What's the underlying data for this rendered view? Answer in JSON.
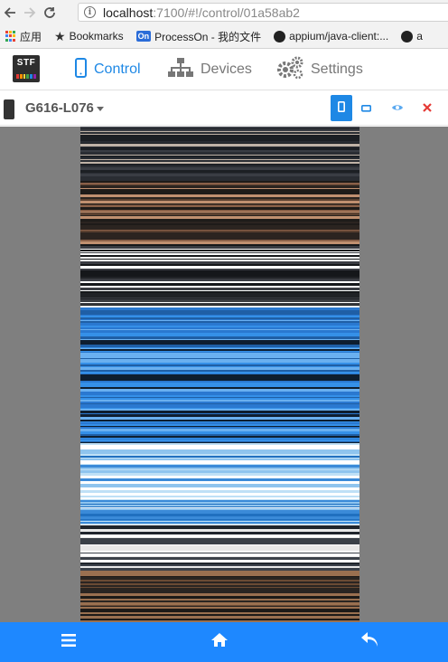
{
  "browser": {
    "url_host": "localhost",
    "url_rest": ":7100/#!/control/01a58ab2"
  },
  "bookmarks": [
    {
      "label": "应用",
      "icon": "apps-grid-icon"
    },
    {
      "label": "Bookmarks",
      "icon": "star-icon"
    },
    {
      "label": "ProcessOn - 我的文件",
      "icon": "processon-icon",
      "badge": "On"
    },
    {
      "label": "appium/java-client:...",
      "icon": "github-icon"
    },
    {
      "label": "a",
      "icon": "github-icon"
    }
  ],
  "logo_text": "STF",
  "nav": {
    "control": "Control",
    "devices": "Devices",
    "settings": "Settings"
  },
  "device": {
    "name": "G616-L076"
  },
  "colors": {
    "accent": "#1e88e5",
    "bottom_bar": "#1e88ff",
    "close": "#e53935"
  }
}
